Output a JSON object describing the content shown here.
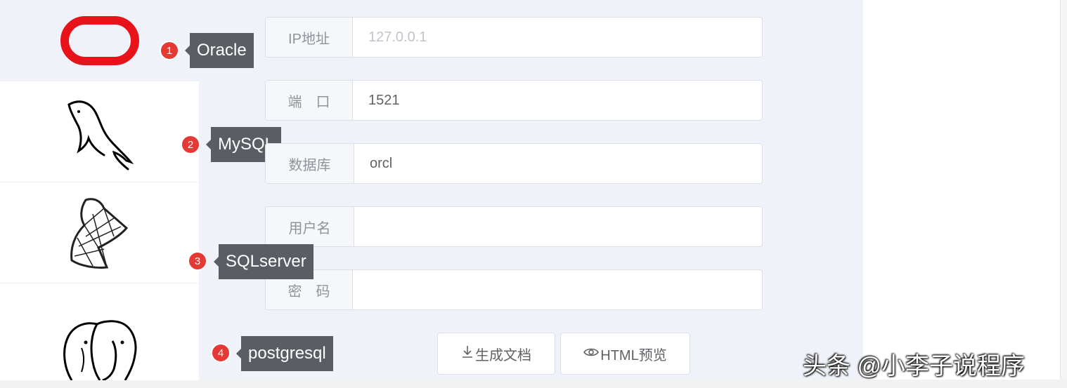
{
  "callouts": [
    {
      "num": "1",
      "label": "Oracle"
    },
    {
      "num": "2",
      "label": "MySQL"
    },
    {
      "num": "3",
      "label": "SQLserver"
    },
    {
      "num": "4",
      "label": "postgresql"
    }
  ],
  "form": {
    "ip_label": "IP地址",
    "ip_placeholder": "127.0.0.1",
    "ip_value": "",
    "port_label": "端　口",
    "port_value": "1521",
    "db_label": "数据库",
    "db_value": "orcl",
    "user_label": "用户名",
    "user_value": "",
    "pwd_label": "密　码",
    "pwd_value": ""
  },
  "buttons": {
    "generate_doc": "生成文档",
    "html_preview": "HTML预览"
  },
  "icons": {
    "oracle": "oracle-logo-icon",
    "mysql": "mysql-dolphin-icon",
    "sqlserver": "sqlserver-logo-icon",
    "postgresql": "postgresql-elephant-icon",
    "download": "download-icon",
    "eye": "eye-icon"
  },
  "colors": {
    "oracle_red": "#e8121b",
    "badge_red": "#e53935",
    "tag_bg": "#5a5d63"
  },
  "watermark": "头条 @小李子说程序"
}
